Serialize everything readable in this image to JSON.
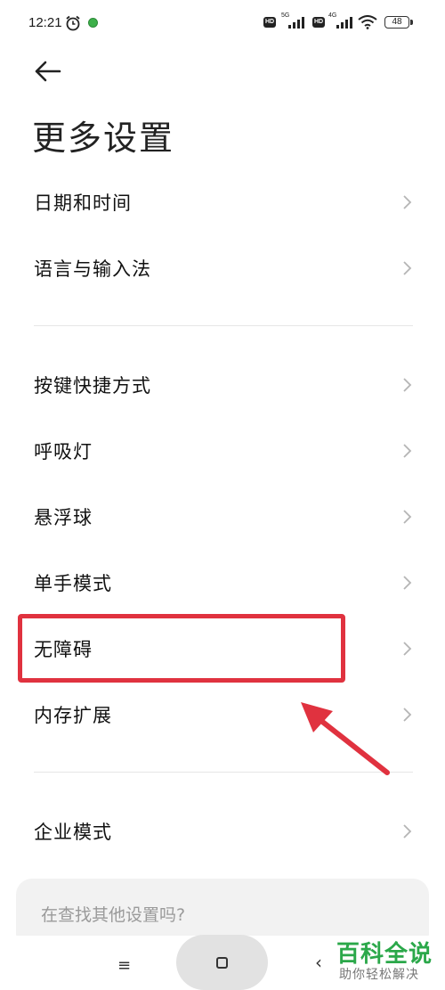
{
  "status_bar": {
    "time": "12:21",
    "network1": "5G",
    "network2": "4G",
    "hd": "HD",
    "battery": "48"
  },
  "header": {
    "title": "更多设置"
  },
  "settings": {
    "item0": "日期和时间",
    "item1": "语言与输入法",
    "item2": "按键快捷方式",
    "item3": "呼吸灯",
    "item4": "悬浮球",
    "item5": "单手模式",
    "item6": "无障碍",
    "item7": "内存扩展",
    "item8": "企业模式"
  },
  "search": {
    "placeholder": "在查找其他设置吗?"
  },
  "nav": {
    "menu": "≡",
    "back": "‹"
  },
  "watermark": {
    "title": "百科全说",
    "subtitle": "助你轻松解决"
  },
  "colors": {
    "highlight": "#e0323f",
    "watermark": "#2ba84a"
  }
}
